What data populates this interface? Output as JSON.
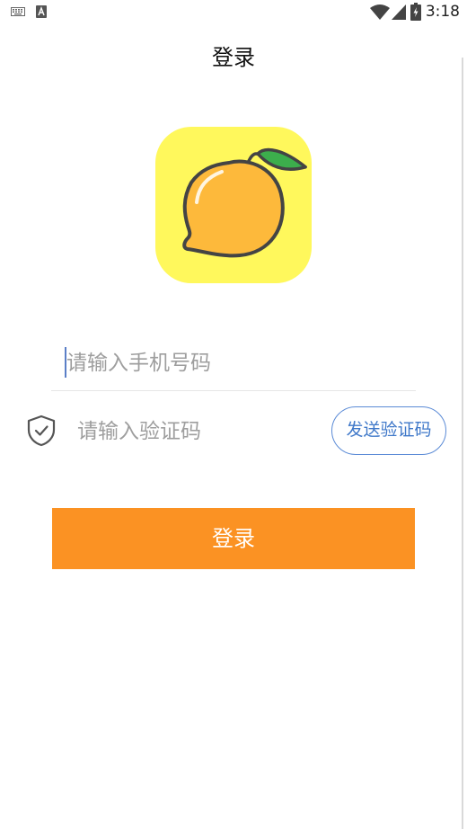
{
  "status_bar": {
    "time": "3:18",
    "icons": [
      "keyboard-icon",
      "text-icon",
      "wifi-icon",
      "signal-icon",
      "battery-icon"
    ]
  },
  "header": {
    "title": "登录"
  },
  "logo": {
    "icon": "mango-icon",
    "background_color": "#fff85c"
  },
  "form": {
    "phone_placeholder": "请输入手机号码",
    "phone_value": "",
    "code_placeholder": "请输入验证码",
    "code_value": "",
    "code_icon": "shield-check-icon",
    "send_code_label": "发送验证码",
    "send_code_color": "#3f78c9"
  },
  "login_button": {
    "label": "登录",
    "color": "#fb9223"
  }
}
